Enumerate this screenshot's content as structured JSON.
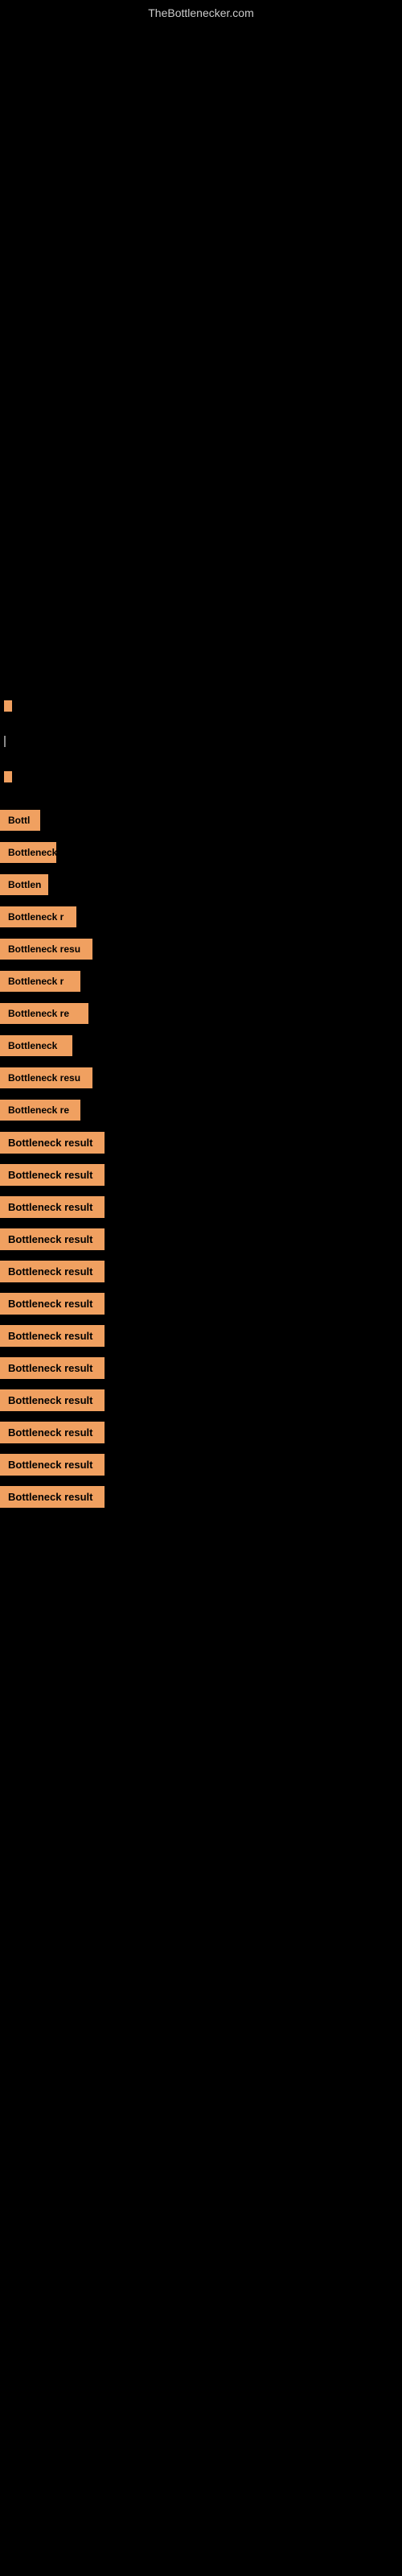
{
  "site": {
    "title": "TheBottlenecker.com"
  },
  "items": [
    {
      "id": 1,
      "label": "Bottl"
    },
    {
      "id": 2,
      "label": "Bottleneck"
    },
    {
      "id": 3,
      "label": "Bottlen"
    },
    {
      "id": 4,
      "label": "Bottleneck r"
    },
    {
      "id": 5,
      "label": "Bottleneck resu"
    },
    {
      "id": 6,
      "label": "Bottleneck r"
    },
    {
      "id": 7,
      "label": "Bottleneck re"
    },
    {
      "id": 8,
      "label": "Bottleneck"
    },
    {
      "id": 9,
      "label": "Bottleneck resu"
    },
    {
      "id": 10,
      "label": "Bottleneck re"
    },
    {
      "id": 11,
      "label": "Bottleneck result"
    },
    {
      "id": 12,
      "label": "Bottleneck result"
    },
    {
      "id": 13,
      "label": "Bottleneck result"
    },
    {
      "id": 14,
      "label": "Bottleneck result"
    },
    {
      "id": 15,
      "label": "Bottleneck result"
    },
    {
      "id": 16,
      "label": "Bottleneck result"
    },
    {
      "id": 17,
      "label": "Bottleneck result"
    },
    {
      "id": 18,
      "label": "Bottleneck result"
    },
    {
      "id": 19,
      "label": "Bottleneck result"
    },
    {
      "id": 20,
      "label": "Bottleneck result"
    },
    {
      "id": 21,
      "label": "Bottleneck result"
    },
    {
      "id": 22,
      "label": "Bottleneck result"
    }
  ]
}
